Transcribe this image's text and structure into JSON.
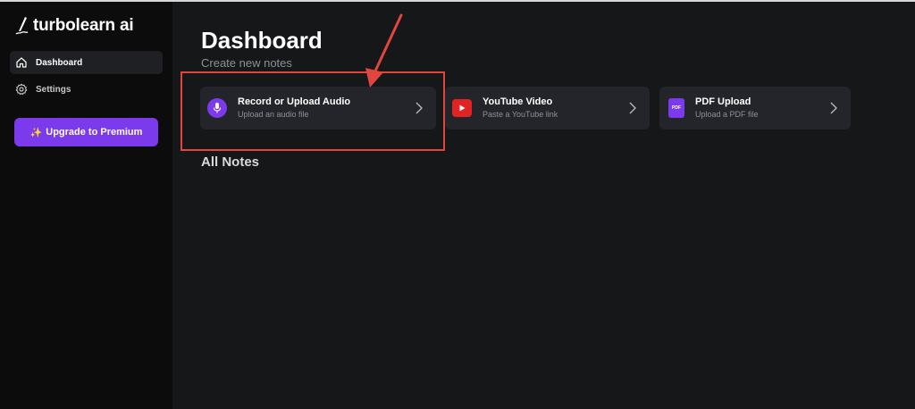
{
  "app": {
    "name": "turbolearn ai"
  },
  "sidebar": {
    "items": [
      {
        "label": "Dashboard",
        "icon": "home-icon",
        "active": true
      },
      {
        "label": "Settings",
        "icon": "gear-icon",
        "active": false
      }
    ],
    "upgrade_label": "Upgrade to Premium",
    "upgrade_icon": "sparkle-icon"
  },
  "main": {
    "title": "Dashboard",
    "subtitle": "Create new notes",
    "cards": [
      {
        "title": "Record or Upload Audio",
        "description": "Upload an audio file",
        "icon": "microphone-icon",
        "icon_color": "#7c3aed"
      },
      {
        "title": "YouTube Video",
        "description": "Paste a YouTube link",
        "icon": "youtube-icon",
        "icon_color": "#e02424"
      },
      {
        "title": "PDF Upload",
        "description": "Upload a PDF file",
        "icon": "pdf-icon",
        "icon_color": "#7c3aed",
        "icon_text": "PDF"
      }
    ],
    "section_title": "All Notes"
  },
  "annotation": {
    "color": "#e0453f"
  },
  "colors": {
    "accent": "#7c3aed",
    "background": "#161719",
    "sidebar": "#0c0c0d",
    "card": "#24252a"
  }
}
